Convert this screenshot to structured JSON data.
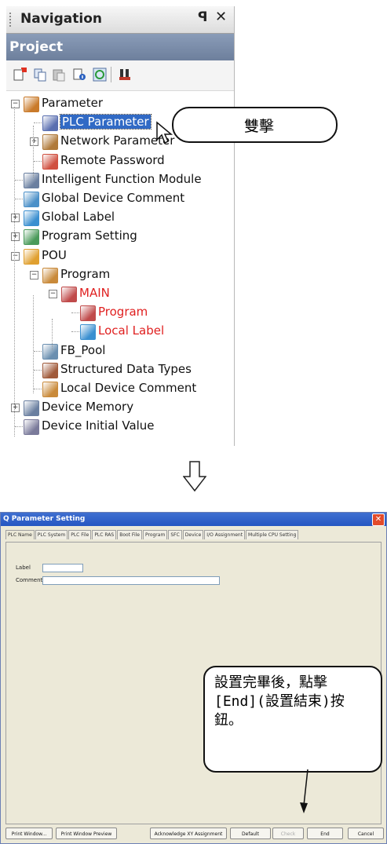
{
  "navigation": {
    "title": "Navigation",
    "pin_glyph": "ꟼ",
    "close_glyph": "✕",
    "project_label": "Project",
    "toolbar_icons": [
      "new-data-icon",
      "copy-icon",
      "paste-icon",
      "properties-icon",
      "refresh-icon",
      "find-icon"
    ],
    "tree": [
      {
        "label": "Parameter",
        "level": 0,
        "expander": "−",
        "icon": "parameter-folder-icon",
        "color": "#c97a2a"
      },
      {
        "label": "PLC Parameter",
        "level": 1,
        "expander": "",
        "icon": "plc-parameter-icon",
        "color": "#5a6fb0",
        "selected": true
      },
      {
        "label": "Network Parameter",
        "level": 1,
        "expander": "+",
        "icon": "network-parameter-icon",
        "color": "#b07a3a"
      },
      {
        "label": "Remote Password",
        "level": 1,
        "expander": "",
        "icon": "remote-password-icon",
        "color": "#d05040"
      },
      {
        "label": "Intelligent Function Module",
        "level": 0,
        "expander": "",
        "icon": "intelligent-module-icon",
        "color": "#6a7fa0"
      },
      {
        "label": "Global Device Comment",
        "level": 0,
        "expander": "",
        "icon": "global-device-comment-icon",
        "color": "#4a90c8"
      },
      {
        "label": "Global Label",
        "level": 0,
        "expander": "+",
        "icon": "global-label-icon",
        "color": "#3a8fd0"
      },
      {
        "label": "Program Setting",
        "level": 0,
        "expander": "+",
        "icon": "program-setting-icon",
        "color": "#4a9a5a"
      },
      {
        "label": "POU",
        "level": 0,
        "expander": "−",
        "icon": "pou-folder-icon",
        "color": "#e0a030"
      },
      {
        "label": "Program",
        "level": 1,
        "expander": "−",
        "icon": "program-folder-icon",
        "color": "#c98a3a"
      },
      {
        "label": "MAIN",
        "level": 2,
        "expander": "−",
        "icon": "main-program-icon",
        "color": "#c04a4a",
        "red": true
      },
      {
        "label": "Program",
        "level": 3,
        "expander": "",
        "icon": "program-body-icon",
        "color": "#c04a4a",
        "red": true
      },
      {
        "label": "Local Label",
        "level": 3,
        "expander": "",
        "icon": "local-label-icon",
        "color": "#3a8fd0",
        "red": true
      },
      {
        "label": "FB_Pool",
        "level": 1,
        "expander": "",
        "icon": "fb-pool-icon",
        "color": "#6a8fb0"
      },
      {
        "label": "Structured Data Types",
        "level": 1,
        "expander": "",
        "icon": "structured-data-types-icon",
        "color": "#a05a3a"
      },
      {
        "label": "Local Device Comment",
        "level": 1,
        "expander": "",
        "icon": "local-device-comment-icon",
        "color": "#c98a3a"
      },
      {
        "label": "Device Memory",
        "level": 0,
        "expander": "+",
        "icon": "device-memory-icon",
        "color": "#6a7fa0"
      },
      {
        "label": "Device Initial Value",
        "level": 0,
        "expander": "",
        "icon": "device-initial-value-icon",
        "color": "#7a7a9a"
      }
    ]
  },
  "callout_top": {
    "text": "雙擊"
  },
  "callout_bottom": {
    "text": "設置完畢後，點擊\n[End](設置結束)按\n鈕。"
  },
  "dialog": {
    "title": "Q Parameter Setting",
    "close_glyph": "✕",
    "tabs": [
      "PLC Name",
      "PLC System",
      "PLC File",
      "PLC RAS",
      "Boot File",
      "Program",
      "SFC",
      "Device",
      "I/O Assignment",
      "Multiple CPU Setting"
    ],
    "label_caption": "Label",
    "comment_caption": "Comment",
    "label_value": "",
    "comment_value": "",
    "buttons": [
      {
        "label": "Print Window...",
        "name": "print-window-button",
        "disabled": false
      },
      {
        "label": "Print Window Preview",
        "name": "print-window-preview-button",
        "disabled": false
      },
      {
        "label": "Acknowledge XY Assignment",
        "name": "acknowledge-xy-assignment-button",
        "disabled": false
      },
      {
        "label": "Default",
        "name": "default-button",
        "disabled": false
      },
      {
        "label": "Check",
        "name": "check-button",
        "disabled": true
      },
      {
        "label": "End",
        "name": "end-button",
        "disabled": false
      },
      {
        "label": "Cancel",
        "name": "cancel-button",
        "disabled": false
      }
    ]
  }
}
